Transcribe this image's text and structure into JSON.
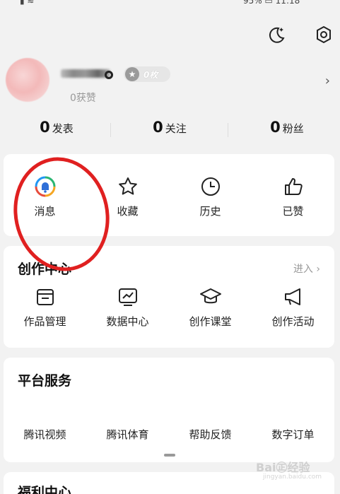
{
  "status": {
    "left": "▮ ≋",
    "battery": "95%",
    "time": "11:18"
  },
  "profile": {
    "badge_text": "0枚",
    "likes": "0获赞"
  },
  "stats": [
    {
      "num": "0",
      "label": "发表"
    },
    {
      "num": "0",
      "label": "关注"
    },
    {
      "num": "0",
      "label": "粉丝"
    }
  ],
  "quick": [
    {
      "label": "消息",
      "icon": "message-icon"
    },
    {
      "label": "收藏",
      "icon": "star-icon"
    },
    {
      "label": "历史",
      "icon": "clock-icon"
    },
    {
      "label": "已赞",
      "icon": "thumbs-up-icon"
    }
  ],
  "creator": {
    "title": "创作中心",
    "enter": "进入",
    "items": [
      {
        "label": "作品管理",
        "icon": "folder-icon"
      },
      {
        "label": "数据中心",
        "icon": "chart-icon"
      },
      {
        "label": "创作课堂",
        "icon": "graduation-cap-icon"
      },
      {
        "label": "创作活动",
        "icon": "megaphone-icon"
      }
    ]
  },
  "platform": {
    "title": "平台服务",
    "items": [
      {
        "label": "腾讯视频"
      },
      {
        "label": "腾讯体育"
      },
      {
        "label": "帮助反馈"
      },
      {
        "label": "数字订单"
      }
    ]
  },
  "welfare": {
    "title": "福利中心"
  },
  "watermark": {
    "brand": "Bai㊣经验",
    "url": "jingyan.baidu.com"
  },
  "colors": {
    "annotation": "#e02020",
    "accent_gradient": [
      "#2bb673",
      "#2196f3",
      "#f5a623",
      "#e74c3c"
    ]
  }
}
